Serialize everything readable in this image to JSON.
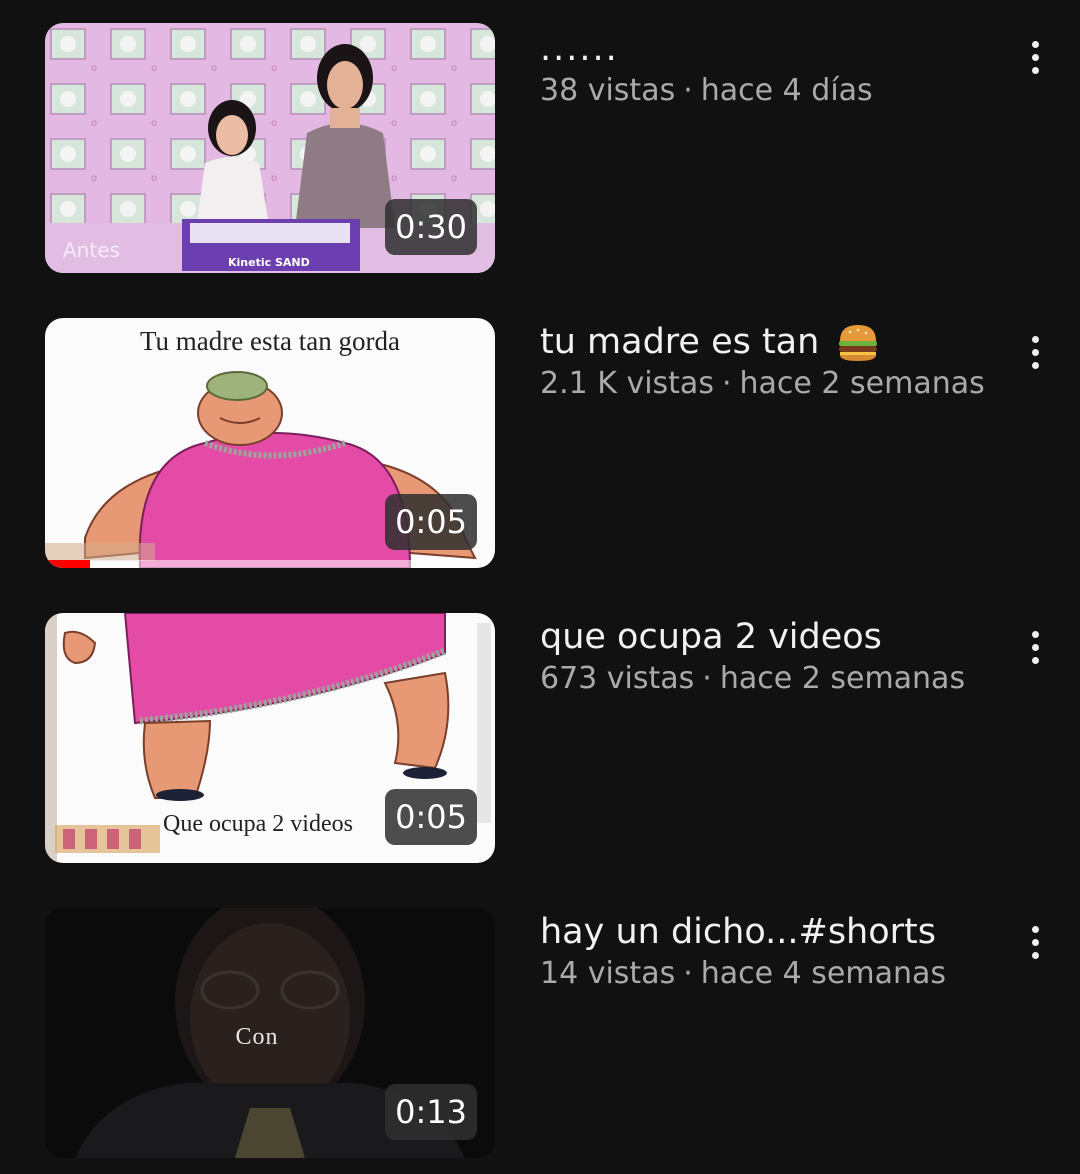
{
  "videos": [
    {
      "title": "......",
      "views": "38 vistas",
      "age": "hace 4 días",
      "duration": "0:30",
      "thumb_caption": "Antes",
      "thumb_brand": "Kinetic SAND"
    },
    {
      "title": "tu madre es tan",
      "title_emoji": "burger-icon",
      "views": "2.1 K vistas",
      "age": "hace 2 semanas",
      "duration": "0:05",
      "thumb_caption": "Tu madre esta tan gorda",
      "watch_progress": 0.1
    },
    {
      "title": "que ocupa 2 videos",
      "views": "673 vistas",
      "age": "hace 2 semanas",
      "duration": "0:05",
      "thumb_caption": "Que ocupa 2 videos"
    },
    {
      "title": "hay un dicho...#shorts",
      "views": "14 vistas",
      "age": "hace 4 semanas",
      "duration": "0:13",
      "thumb_caption": "Con"
    }
  ],
  "meta_separator": "·",
  "menu_icon": "more-vert-icon",
  "colors": {
    "background": "#111111",
    "title": "#f1f1f1",
    "meta": "#aaaaaa",
    "progress": "#ff0000"
  }
}
